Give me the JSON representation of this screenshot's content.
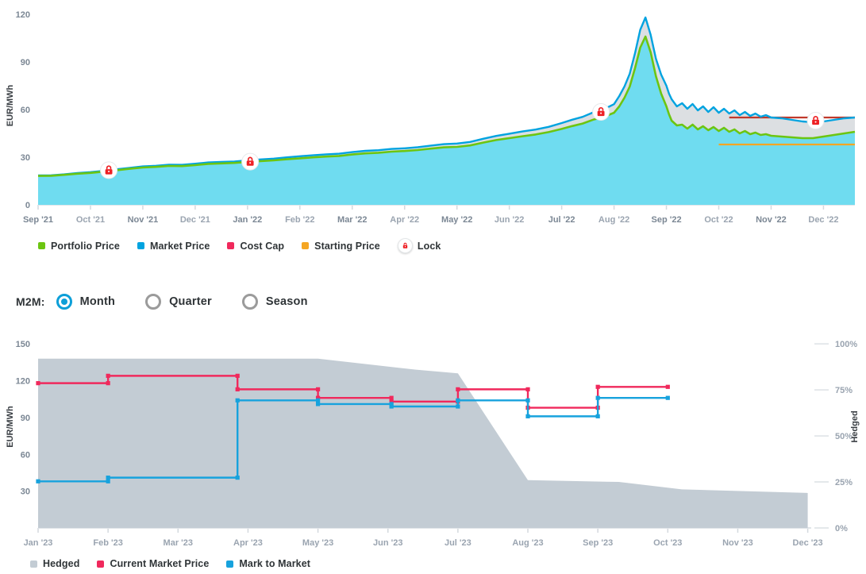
{
  "top_chart": {
    "y_axis_title": "EUR/MWh",
    "y_ticks": [
      "0",
      "30",
      "60",
      "90",
      "120"
    ],
    "x_ticks": [
      "Sep '21",
      "Oct '21",
      "Nov '21",
      "Dec '21",
      "Jan '22",
      "Feb '22",
      "Mar '22",
      "Apr '22",
      "May '22",
      "Jun '22",
      "Jul '22",
      "Aug '22",
      "Sep '22",
      "Oct '22",
      "Nov '22",
      "Dec '22"
    ],
    "legend": [
      {
        "label": "Portfolio Price",
        "color": "#6cc511",
        "icon": "square-swatch"
      },
      {
        "label": "Market Price",
        "color": "#00a3e0",
        "icon": "square-swatch"
      },
      {
        "label": "Cost Cap",
        "color": "#f0295c",
        "icon": "square-swatch"
      },
      {
        "label": "Starting Price",
        "color": "#f5a623",
        "icon": "square-swatch"
      },
      {
        "label": "Lock",
        "color": "#ee2024",
        "icon": "lock-icon"
      }
    ]
  },
  "m2m": {
    "label": "M2M:",
    "options": [
      {
        "label": "Month",
        "selected": true
      },
      {
        "label": "Quarter",
        "selected": false
      },
      {
        "label": "Season",
        "selected": false
      }
    ]
  },
  "bottom_chart": {
    "y_axis_title": "EUR/MWh",
    "y2_axis_title": "Hedged",
    "y_ticks": [
      "30",
      "60",
      "90",
      "120",
      "150"
    ],
    "y2_ticks": [
      "0%",
      "25%",
      "50%",
      "75%",
      "100%"
    ],
    "x_ticks": [
      "Jan '23",
      "Feb '23",
      "Mar '23",
      "Apr '23",
      "May '23",
      "Jun '23",
      "Jul '23",
      "Aug '23",
      "Sep '23",
      "Oct '23",
      "Nov '23",
      "Dec '23"
    ],
    "legend": [
      {
        "label": "Hedged",
        "color": "#c3ccd4",
        "icon": "square-swatch"
      },
      {
        "label": "Current Market Price",
        "color": "#f0295c",
        "icon": "square-swatch"
      },
      {
        "label": "Mark to Market",
        "color": "#17a2dd",
        "icon": "square-swatch"
      }
    ]
  },
  "chart_data": [
    {
      "type": "area",
      "id": "portfolio-vs-market",
      "title": "",
      "xlabel": "",
      "ylabel": "EUR/MWh",
      "ylim": [
        0,
        125
      ],
      "grid": true,
      "legend_position": "bottom-left",
      "x_categories": [
        "Sep '21",
        "Oct '21",
        "Nov '21",
        "Dec '21",
        "Jan '22",
        "Feb '22",
        "Mar '22",
        "Apr '22",
        "May '22",
        "Jun '22",
        "Jul '22",
        "Aug '22",
        "Sep '22",
        "Oct '22",
        "Nov '22",
        "Dec '22"
      ],
      "x_domain": [
        0,
        15.6
      ],
      "series": [
        {
          "name": "Market Price",
          "color": "#00a3e0",
          "fill": "#6fdcf0",
          "x": [
            0,
            0.25,
            0.5,
            0.75,
            1,
            1.25,
            1.5,
            1.75,
            2,
            2.25,
            2.5,
            2.75,
            3,
            3.25,
            3.5,
            3.75,
            4,
            4.25,
            4.5,
            4.75,
            5,
            5.25,
            5.5,
            5.75,
            6,
            6.25,
            6.5,
            6.75,
            7,
            7.25,
            7.5,
            7.75,
            8,
            8.25,
            8.5,
            8.75,
            9,
            9.25,
            9.5,
            9.75,
            10,
            10.2,
            10.4,
            10.6,
            10.8,
            11,
            11.1,
            11.2,
            11.3,
            11.4,
            11.5,
            11.6,
            11.7,
            11.8,
            11.9,
            12,
            12.05,
            12.1,
            12.2,
            12.3,
            12.4,
            12.5,
            12.6,
            12.7,
            12.8,
            12.9,
            13,
            13.1,
            13.2,
            13.3,
            13.4,
            13.5,
            13.6,
            13.7,
            13.8,
            13.9,
            14,
            14.2,
            14.4,
            14.6,
            14.8,
            15,
            15.2,
            15.4,
            15.6
          ],
          "y": [
            18.5,
            18.6,
            19.2,
            20,
            20.6,
            21.4,
            22.4,
            23.3,
            24.2,
            24.6,
            25.3,
            25.2,
            25.9,
            26.7,
            27,
            27.3,
            28,
            28.6,
            29.1,
            29.9,
            30.6,
            31.2,
            31.8,
            32.2,
            33.2,
            34,
            34.4,
            35.2,
            35.6,
            36.3,
            37.3,
            38.2,
            38.6,
            39.6,
            41.6,
            43.4,
            44.8,
            46.2,
            47.4,
            49.1,
            51.5,
            53.6,
            55.4,
            58.2,
            60.1,
            63.4,
            68.5,
            74.6,
            82.6,
            95.4,
            110.2,
            118,
            107,
            92,
            82,
            75,
            70,
            66.5,
            62,
            64,
            60.5,
            63.5,
            59.5,
            62,
            58.5,
            61.5,
            58,
            60.5,
            57.5,
            59.5,
            56.5,
            58.5,
            56,
            57.5,
            55.5,
            56.5,
            55,
            54.5,
            53.5,
            52.5,
            52,
            52.5,
            53.5,
            54.5,
            55
          ]
        },
        {
          "name": "Portfolio Price",
          "color": "#6cc511",
          "x": [
            0,
            0.25,
            0.5,
            0.75,
            1,
            1.25,
            1.5,
            1.75,
            2,
            2.25,
            2.5,
            2.75,
            3,
            3.25,
            3.5,
            3.75,
            4,
            4.25,
            4.5,
            4.75,
            5,
            5.25,
            5.5,
            5.75,
            6,
            6.25,
            6.5,
            6.75,
            7,
            7.25,
            7.5,
            7.75,
            8,
            8.25,
            8.5,
            8.75,
            9,
            9.25,
            9.5,
            9.75,
            10,
            10.2,
            10.4,
            10.6,
            10.8,
            11,
            11.1,
            11.2,
            11.3,
            11.4,
            11.5,
            11.6,
            11.7,
            11.8,
            11.9,
            12,
            12.05,
            12.1,
            12.2,
            12.3,
            12.4,
            12.5,
            12.6,
            12.7,
            12.8,
            12.9,
            13,
            13.1,
            13.2,
            13.3,
            13.4,
            13.5,
            13.6,
            13.7,
            13.8,
            13.9,
            14,
            14.2,
            14.4,
            14.6,
            14.8,
            15,
            15.2,
            15.4,
            15.6
          ],
          "y": [
            18.2,
            18.3,
            18.9,
            19.6,
            20.1,
            20.9,
            21.8,
            22.7,
            23.5,
            23.9,
            24.5,
            24.4,
            25,
            25.8,
            26.1,
            26.4,
            27,
            27.5,
            28,
            28.7,
            29.3,
            29.9,
            30.4,
            30.8,
            31.7,
            32.4,
            32.8,
            33.5,
            33.9,
            34.5,
            35.4,
            36.2,
            36.5,
            37.4,
            39.2,
            40.8,
            42,
            43.2,
            44.3,
            45.8,
            47.8,
            49.6,
            51.2,
            53.6,
            55.3,
            58,
            62,
            67.5,
            74.5,
            86,
            99,
            106,
            96,
            81,
            70,
            62,
            57,
            53,
            50,
            50.5,
            48,
            50.5,
            47.5,
            49.5,
            47,
            49,
            46.5,
            48.5,
            46,
            47.5,
            45,
            46.5,
            44.5,
            45.5,
            44,
            44.5,
            43.5,
            43,
            42.5,
            42,
            42,
            43,
            44,
            45,
            46
          ]
        }
      ],
      "reference_lines": [
        {
          "name": "Cost Cap",
          "color": "#c0392b",
          "value": 55,
          "x_start": 13.2,
          "x_end": 15.6
        },
        {
          "name": "Starting Price",
          "color": "#f5a623",
          "value": 38,
          "x_start": 13.0,
          "x_end": 15.6
        }
      ],
      "markers": [
        {
          "name": "Lock",
          "x": 1.35,
          "y": 21.8,
          "icon": "lock-icon"
        },
        {
          "name": "Lock",
          "x": 4.05,
          "y": 27.2,
          "icon": "lock-icon"
        },
        {
          "name": "Lock",
          "x": 10.75,
          "y": 58.5,
          "icon": "lock-icon"
        },
        {
          "name": "Lock",
          "x": 14.85,
          "y": 53.0,
          "icon": "lock-icon"
        }
      ]
    },
    {
      "type": "line",
      "id": "hedged-mark-to-market",
      "title": "",
      "xlabel": "",
      "ylabel": "EUR/MWh",
      "y2label": "Hedged",
      "ylim": [
        0,
        165
      ],
      "y2lim": [
        0,
        110
      ],
      "grid": true,
      "legend_position": "bottom-left",
      "x_categories": [
        "Jan '23",
        "Feb '23",
        "Mar '23",
        "Apr '23",
        "May '23",
        "Jun '23",
        "Jul '23",
        "Aug '23",
        "Sep '23",
        "Oct '23",
        "Nov '23",
        "Dec '23"
      ],
      "series": [
        {
          "name": "Hedged",
          "type": "area",
          "color": "#c3ccd4",
          "unit": "%",
          "points": [
            {
              "x": 0,
              "y": 92
            },
            {
              "x": 4.0,
              "y": 92
            },
            {
              "x": 5.4,
              "y": 86
            },
            {
              "x": 6.0,
              "y": 84
            },
            {
              "x": 7.0,
              "y": 26
            },
            {
              "x": 8.3,
              "y": 25
            },
            {
              "x": 9.2,
              "y": 21
            },
            {
              "x": 11.0,
              "y": 19
            }
          ]
        },
        {
          "name": "Current Market Price",
          "type": "step",
          "color": "#f0295c",
          "unit": "EUR/MWh",
          "steps": [
            {
              "x_start": 0.0,
              "x_end": 1.0,
              "y": 118
            },
            {
              "x_start": 1.0,
              "x_end": 2.85,
              "y": 124
            },
            {
              "x_start": 2.85,
              "x_end": 4.0,
              "y": 113
            },
            {
              "x_start": 4.0,
              "x_end": 5.05,
              "y": 106
            },
            {
              "x_start": 5.05,
              "x_end": 6.0,
              "y": 103
            },
            {
              "x_start": 6.0,
              "x_end": 7.0,
              "y": 113
            },
            {
              "x_start": 7.0,
              "x_end": 8.0,
              "y": 98
            },
            {
              "x_start": 8.0,
              "x_end": 9.0,
              "y": 115
            }
          ]
        },
        {
          "name": "Mark to Market",
          "type": "step",
          "color": "#17a2dd",
          "unit": "EUR/MWh",
          "steps": [
            {
              "x_start": 0.0,
              "x_end": 1.0,
              "y": 38
            },
            {
              "x_start": 1.0,
              "x_end": 2.85,
              "y": 41
            },
            {
              "x_start": 2.85,
              "x_end": 4.0,
              "y": 104
            },
            {
              "x_start": 4.0,
              "x_end": 5.05,
              "y": 101
            },
            {
              "x_start": 5.05,
              "x_end": 6.0,
              "y": 99
            },
            {
              "x_start": 6.0,
              "x_end": 7.0,
              "y": 104
            },
            {
              "x_start": 7.0,
              "x_end": 8.0,
              "y": 91
            },
            {
              "x_start": 8.0,
              "x_end": 9.0,
              "y": 106
            }
          ]
        }
      ]
    }
  ]
}
